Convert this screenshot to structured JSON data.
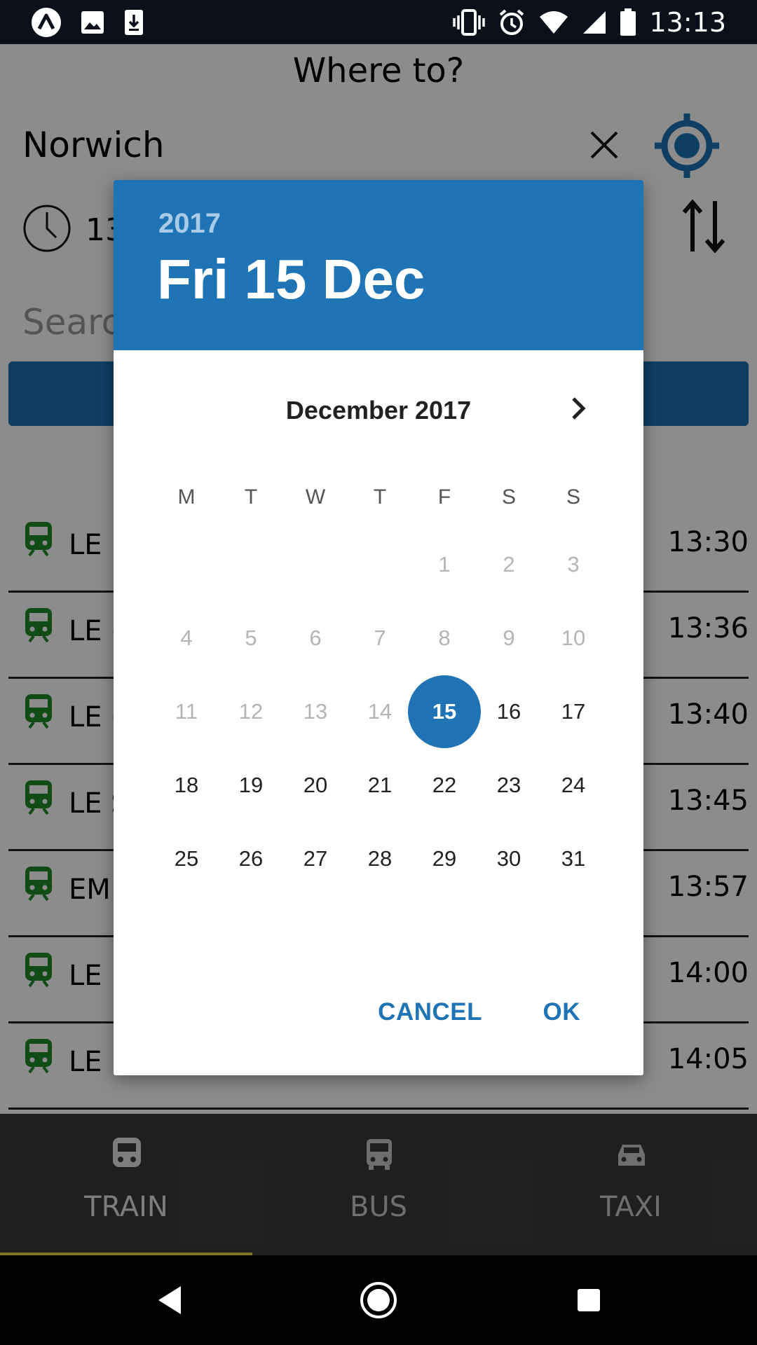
{
  "status_bar": {
    "time": "13:13",
    "left_icons": [
      "app-notification-icon",
      "image-icon",
      "download-icon"
    ],
    "right_icons": [
      "vibrate-icon",
      "alarm-icon",
      "wifi-icon",
      "signal-icon",
      "battery-icon"
    ]
  },
  "header": {
    "title": "Where to?",
    "destination": "Norwich",
    "time_partial": "13",
    "search_placeholder": "Searc"
  },
  "departures": [
    {
      "service": "LE I",
      "time": "13:30"
    },
    {
      "service": "LE (",
      "time": "13:36"
    },
    {
      "service": "LE (",
      "time": "13:40"
    },
    {
      "service": "LE S",
      "time": "13:45"
    },
    {
      "service": "EM",
      "time": "13:57"
    },
    {
      "service": "LE I",
      "time": "14:00"
    },
    {
      "service": "LE I",
      "time": "14:05"
    }
  ],
  "bottom_nav": {
    "items": [
      {
        "label": "TRAIN",
        "icon": "train-icon",
        "active": true
      },
      {
        "label": "BUS",
        "icon": "bus-icon",
        "active": false
      },
      {
        "label": "TAXI",
        "icon": "taxi-icon",
        "active": false
      }
    ]
  },
  "date_picker": {
    "year": "2017",
    "selected_date": "Fri 15 Dec",
    "month_label": "December 2017",
    "weekdays": [
      "M",
      "T",
      "W",
      "T",
      "F",
      "S",
      "S"
    ],
    "weeks": [
      [
        {
          "day": ""
        },
        {
          "day": ""
        },
        {
          "day": ""
        },
        {
          "day": ""
        },
        {
          "day": "1",
          "state": "disabled"
        },
        {
          "day": "2",
          "state": "disabled"
        },
        {
          "day": "3",
          "state": "disabled"
        }
      ],
      [
        {
          "day": "4",
          "state": "disabled"
        },
        {
          "day": "5",
          "state": "disabled"
        },
        {
          "day": "6",
          "state": "disabled"
        },
        {
          "day": "7",
          "state": "disabled"
        },
        {
          "day": "8",
          "state": "disabled"
        },
        {
          "day": "9",
          "state": "disabled"
        },
        {
          "day": "10",
          "state": "disabled"
        }
      ],
      [
        {
          "day": "11",
          "state": "disabled"
        },
        {
          "day": "12",
          "state": "disabled"
        },
        {
          "day": "13",
          "state": "disabled"
        },
        {
          "day": "14",
          "state": "disabled"
        },
        {
          "day": "15",
          "state": "selected"
        },
        {
          "day": "16",
          "state": "enabled"
        },
        {
          "day": "17",
          "state": "enabled"
        }
      ],
      [
        {
          "day": "18",
          "state": "enabled"
        },
        {
          "day": "19",
          "state": "enabled"
        },
        {
          "day": "20",
          "state": "enabled"
        },
        {
          "day": "21",
          "state": "enabled"
        },
        {
          "day": "22",
          "state": "enabled"
        },
        {
          "day": "23",
          "state": "enabled"
        },
        {
          "day": "24",
          "state": "enabled"
        }
      ],
      [
        {
          "day": "25",
          "state": "enabled"
        },
        {
          "day": "26",
          "state": "enabled"
        },
        {
          "day": "27",
          "state": "enabled"
        },
        {
          "day": "28",
          "state": "enabled"
        },
        {
          "day": "29",
          "state": "enabled"
        },
        {
          "day": "30",
          "state": "enabled"
        },
        {
          "day": "31",
          "state": "enabled"
        }
      ]
    ],
    "cancel_label": "CANCEL",
    "ok_label": "OK"
  },
  "colors": {
    "accent": "#1e74b4",
    "train_icon": "#1f8a2a",
    "status_bar": "#0b0f1a",
    "nav_indicator": "#e6d44a"
  }
}
